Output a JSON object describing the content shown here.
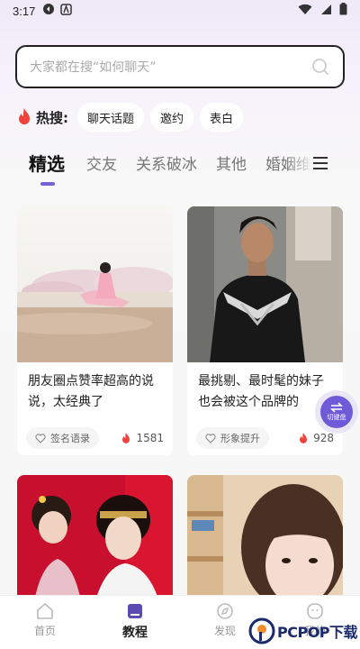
{
  "status_bar": {
    "time": "3:17"
  },
  "search": {
    "placeholder": "大家都在搜“如何聊天”"
  },
  "hot": {
    "label": "热搜:",
    "tags": [
      "聊天话题",
      "邀约",
      "表白"
    ]
  },
  "tabs": [
    {
      "label": "精选",
      "active": true
    },
    {
      "label": "交友"
    },
    {
      "label": "关系破冰"
    },
    {
      "label": "其他"
    },
    {
      "label": "婚姻维"
    }
  ],
  "cards": [
    {
      "title": "朋友圈点赞率超高的说说，太经典了",
      "tag": "签名语录",
      "likes": "1581"
    },
    {
      "title": "最挑剔、最时髦的妹子也会被这个品牌的",
      "tag": "形象提升",
      "likes": "928"
    },
    {
      "title": "",
      "tag": "",
      "likes": ""
    },
    {
      "title": "",
      "tag": "",
      "likes": ""
    }
  ],
  "float_button": {
    "label": "切键盘"
  },
  "bottom_nav": [
    {
      "label": "首页"
    },
    {
      "label": "教程",
      "active": true
    },
    {
      "label": "发现"
    },
    {
      "label": "我的"
    }
  ],
  "watermark": {
    "text": "PCPOP下载"
  },
  "colors": {
    "accent": "#7563d6",
    "flame": "#f0433b"
  }
}
